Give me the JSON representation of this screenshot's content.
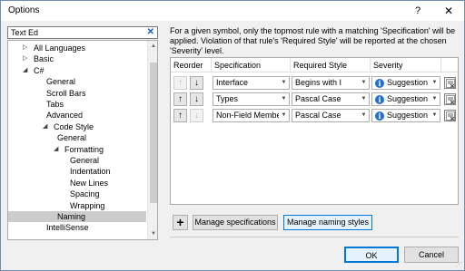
{
  "window": {
    "title": "Options",
    "help_glyph": "?",
    "close_glyph": "✕"
  },
  "search": {
    "value": "Text Ed",
    "clear_glyph": "✕"
  },
  "tree": {
    "items": [
      {
        "label": "All Languages",
        "arrow": "▷"
      },
      {
        "label": "Basic",
        "arrow": "▷"
      },
      {
        "label": "C#",
        "arrow": "◢"
      },
      {
        "label": "General",
        "arrow": ""
      },
      {
        "label": "Scroll Bars",
        "arrow": ""
      },
      {
        "label": "Tabs",
        "arrow": ""
      },
      {
        "label": "Advanced",
        "arrow": ""
      },
      {
        "label": "Code Style",
        "arrow": "◢"
      },
      {
        "label": "General",
        "arrow": ""
      },
      {
        "label": "Formatting",
        "arrow": "◢"
      },
      {
        "label": "General",
        "arrow": ""
      },
      {
        "label": "Indentation",
        "arrow": ""
      },
      {
        "label": "New Lines",
        "arrow": ""
      },
      {
        "label": "Spacing",
        "arrow": ""
      },
      {
        "label": "Wrapping",
        "arrow": ""
      },
      {
        "label": "Naming",
        "arrow": "",
        "selected": true
      },
      {
        "label": "IntelliSense",
        "arrow": ""
      }
    ]
  },
  "description": "For a given symbol, only the topmost rule with a matching 'Specification' will be applied. Violation of that rule's 'Required Style' will be reported at the chosen 'Severity' level.",
  "grid": {
    "headers": {
      "reorder": "Reorder",
      "specification": "Specification",
      "required_style": "Required Style",
      "severity": "Severity"
    },
    "rows": [
      {
        "specification": "Interface",
        "required_style": "Begins with I",
        "severity": "Suggestion",
        "up_enabled": false,
        "down_enabled": true
      },
      {
        "specification": "Types",
        "required_style": "Pascal Case",
        "severity": "Suggestion",
        "up_enabled": true,
        "down_enabled": true
      },
      {
        "specification": "Non-Field Members",
        "required_style": "Pascal Case",
        "severity": "Suggestion",
        "up_enabled": true,
        "down_enabled": false
      }
    ]
  },
  "glyphs": {
    "up": "↑",
    "down": "↓",
    "dropdown": "▼",
    "info": "i",
    "add": "+"
  },
  "buttons": {
    "manage_specifications": "Manage specifications",
    "manage_naming_styles": "Manage naming styles",
    "ok": "OK",
    "cancel": "Cancel"
  },
  "colors": {
    "accent": "#0078d7",
    "info": "#1e6fd9",
    "selected_row": "#cccccc"
  }
}
